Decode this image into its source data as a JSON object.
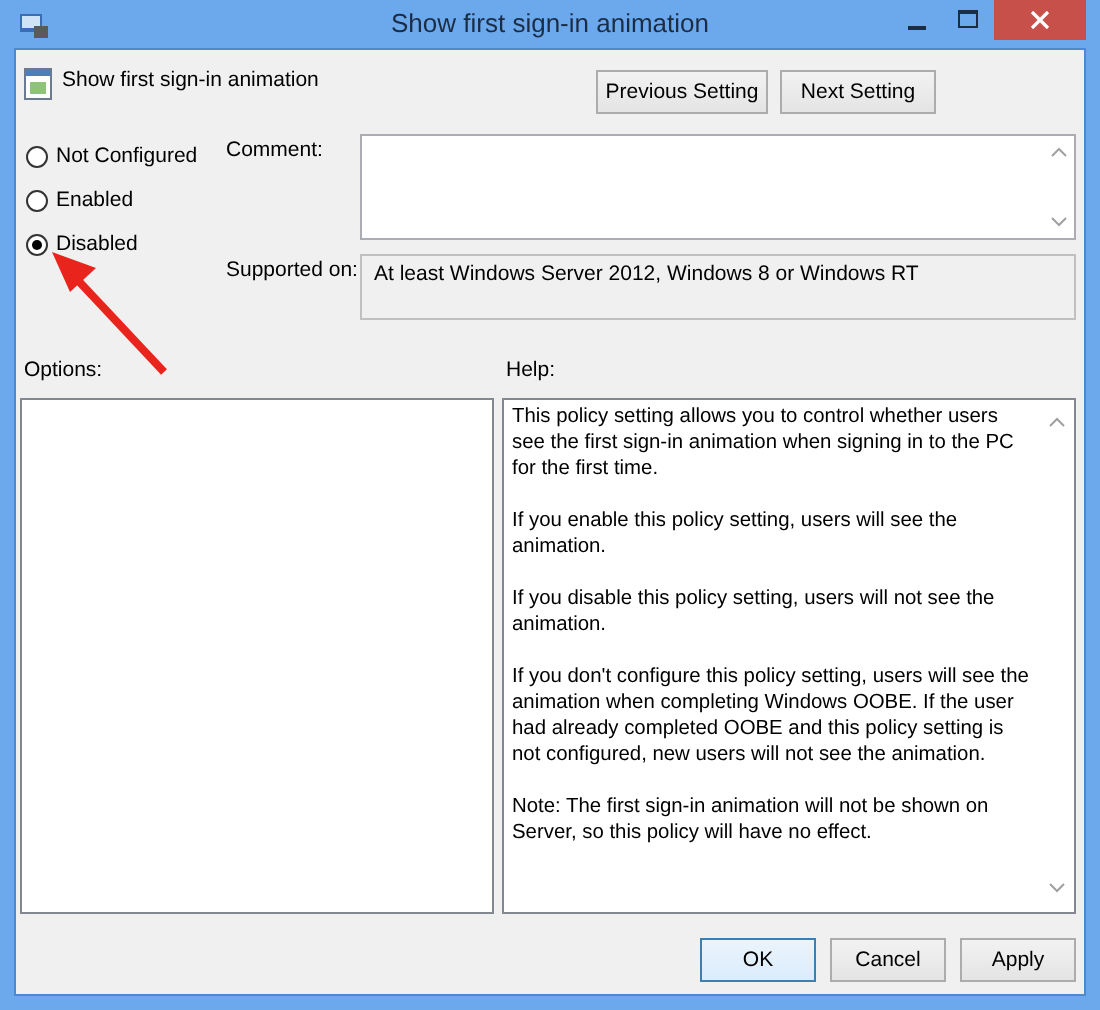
{
  "window": {
    "title": "Show first sign-in animation"
  },
  "policy": {
    "name": "Show first sign-in animation"
  },
  "nav_buttons": [
    "Previous Setting",
    "Next Setting"
  ],
  "states": [
    {
      "label": "Not Configured",
      "selected": false
    },
    {
      "label": "Enabled",
      "selected": false
    },
    {
      "label": "Disabled",
      "selected": true
    }
  ],
  "comment": {
    "label": "Comment:"
  },
  "supported_on": {
    "label": "Supported on:",
    "value": "At least Windows Server 2012, Windows 8 or Windows RT"
  },
  "options": {
    "label": "Options:"
  },
  "help": {
    "label": "Help:",
    "paragraphs": [
      "This policy setting allows you to control whether users see the first sign-in animation when signing in to the PC for the first time.",
      "If you enable this policy setting, users will see the animation.",
      "If you disable this policy setting, users will not see the animation.",
      "If you don't configure this policy setting, users will see the animation when completing Windows OOBE.  If the user had already completed OOBE and this policy setting is not configured, new users will not see the animation.",
      "Note: The first sign-in animation will not be shown on Server, so this policy will have no effect."
    ]
  },
  "buttons": [
    {
      "label": "OK",
      "kind": "default"
    },
    {
      "label": "Cancel",
      "kind": "normal"
    },
    {
      "label": "Apply",
      "kind": "normal"
    }
  ]
}
